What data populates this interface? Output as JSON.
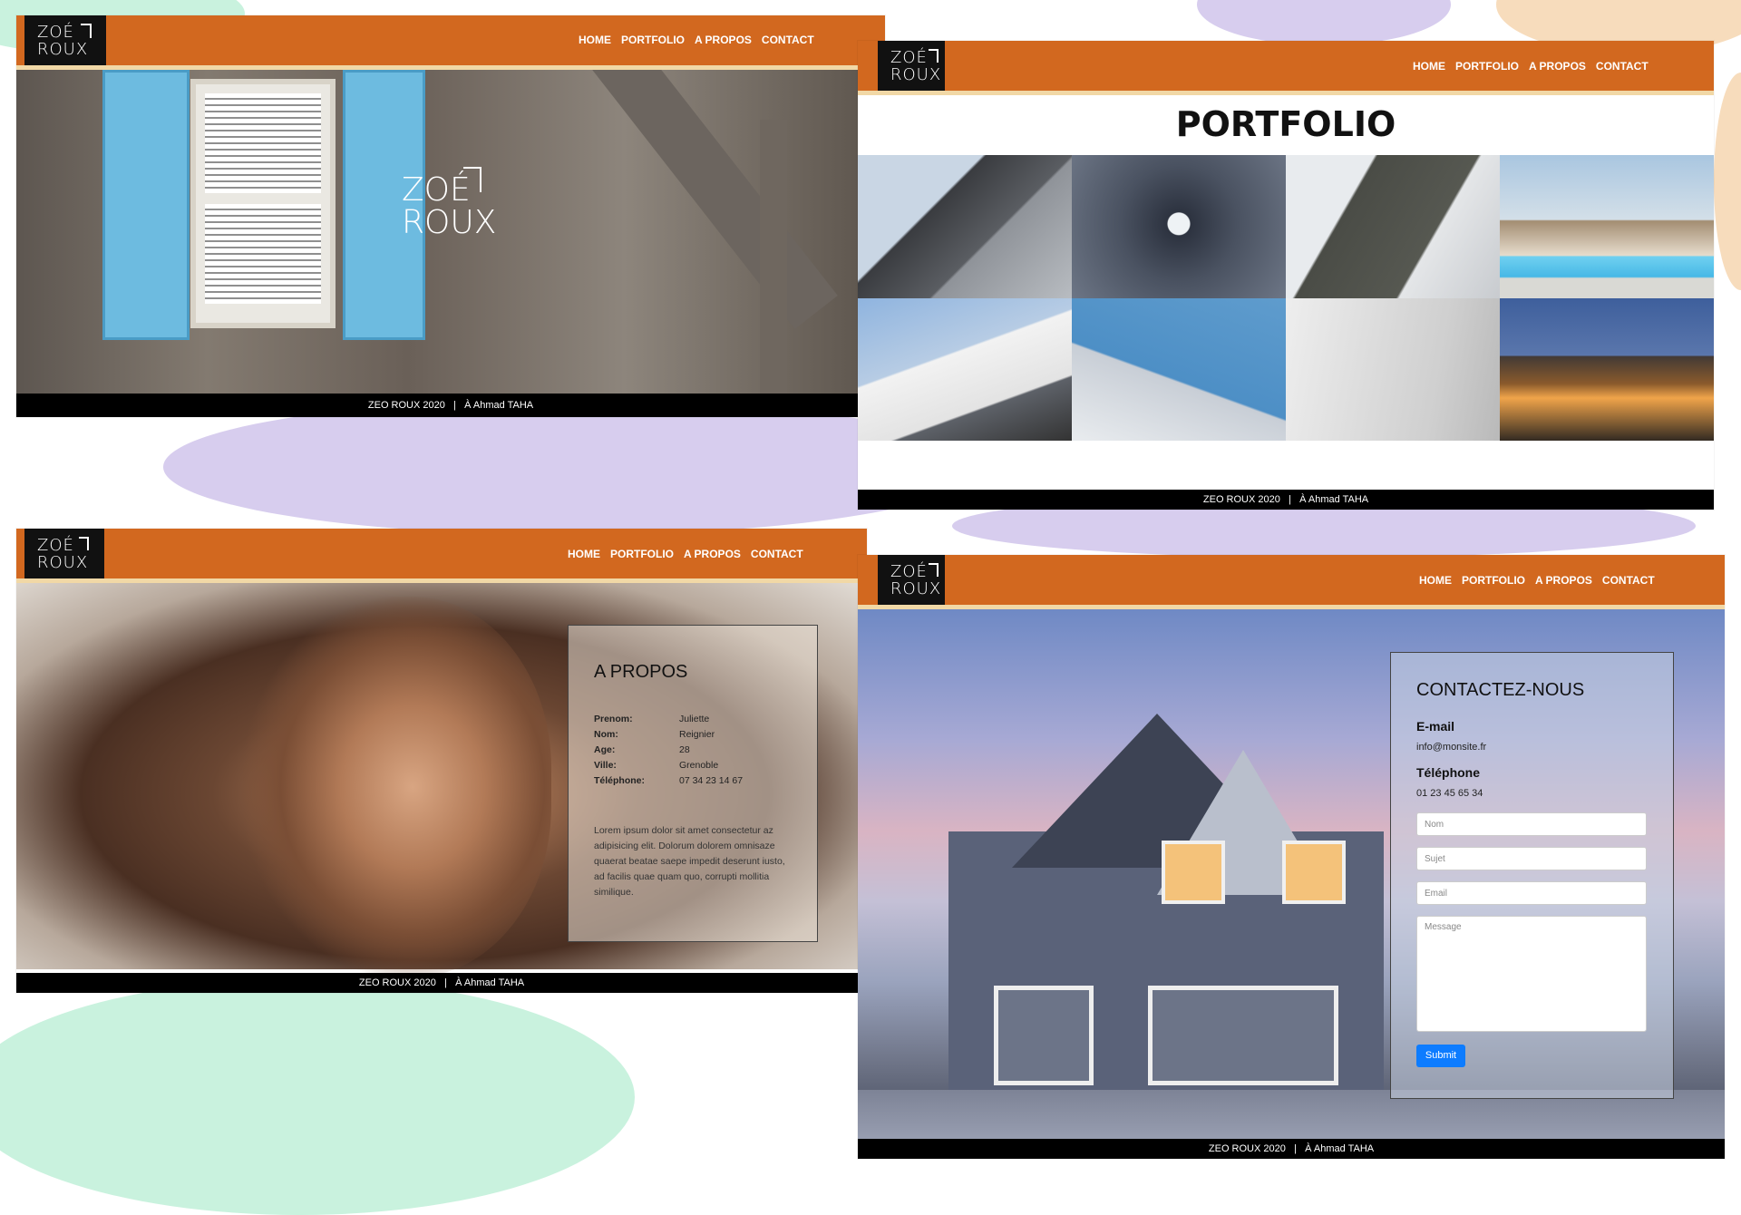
{
  "brand": {
    "line1": "ZOÉ",
    "line2": "ROUX"
  },
  "nav": {
    "items": [
      "HOME",
      "PORTFOLIO",
      "A PROPOS",
      "CONTACT"
    ]
  },
  "footer": {
    "copyright": "ZEO ROUX 2020",
    "separator": "|",
    "credit": "À Ahmad TAHA"
  },
  "home": {
    "hero_line1": "ZOÉ",
    "hero_line2": "ROUX"
  },
  "portfolio": {
    "title": "PORTFOLIO"
  },
  "about": {
    "title": "A PROPOS",
    "fields": [
      {
        "label": "Prenom:",
        "value": "Juliette"
      },
      {
        "label": "Nom:",
        "value": "Reignier"
      },
      {
        "label": "Age:",
        "value": "28"
      },
      {
        "label": "Ville:",
        "value": "Grenoble"
      },
      {
        "label": "Téléphone:",
        "value": "07 34 23 14 67"
      }
    ],
    "bio": "Lorem ipsum dolor sit amet consectetur az adipisicing elit. Dolorum dolorem omnisaze quaerat beatae saepe impedit deserunt iusto, ad facilis quae quam quo, corrupti mollitia similique."
  },
  "contact": {
    "title": "CONTACTEZ-NOUS",
    "email_label": "E-mail",
    "email_value": "info@monsite.fr",
    "phone_label": "Téléphone",
    "phone_value": "01 23 45 65 34",
    "placeholders": {
      "name": "Nom",
      "subject": "Sujet",
      "email": "Email",
      "message": "Message"
    },
    "submit": "Submit"
  },
  "colors": {
    "nav": "#d2681f",
    "accent_line": "#f1d8a6",
    "footer": "#000000",
    "logo_bg": "#111111",
    "submit": "#0d7cff"
  }
}
